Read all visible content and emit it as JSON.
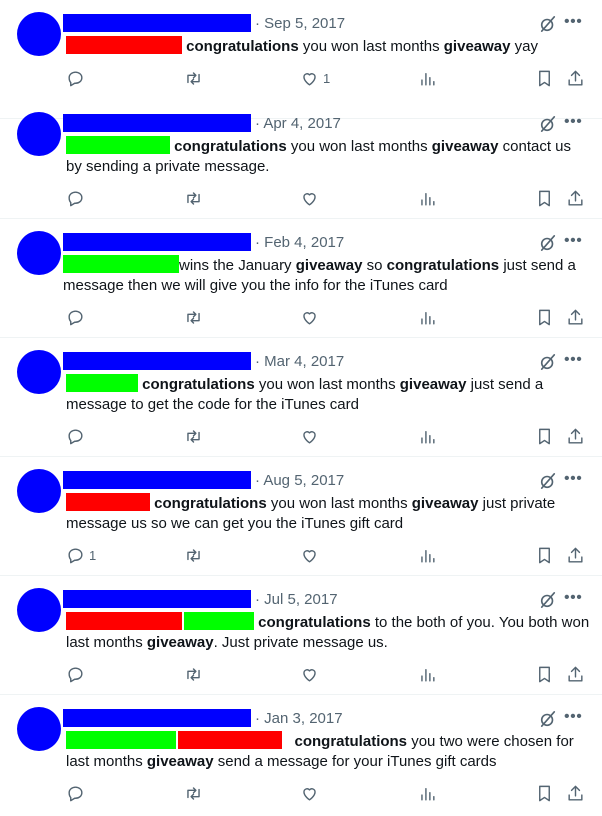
{
  "colors": {
    "avatar": "#0000ff",
    "name_redaction": "#0000ff",
    "red_redaction": "#ff0000",
    "green_redaction": "#00ff00",
    "muted": "#536471"
  },
  "icons": [
    "grok-icon",
    "more-icon",
    "reply-icon",
    "retweet-icon",
    "like-icon",
    "views-icon",
    "bookmark-icon",
    "share-icon"
  ],
  "tweets": [
    {
      "date": "· Sep 5, 2017",
      "segments": [
        [
          "congratulations",
          true
        ],
        [
          " you won last months ",
          false
        ],
        [
          "giveaway",
          true
        ],
        [
          " yay",
          false
        ]
      ],
      "reply_count": "",
      "like_count": "1"
    },
    {
      "date": "· Apr 4, 2017",
      "segments": [
        [
          "congratulations",
          true
        ],
        [
          " you won last months ",
          false
        ],
        [
          "giveaway",
          true
        ],
        [
          " contact us by sending a private message.",
          false
        ]
      ],
      "reply_count": "",
      "like_count": ""
    },
    {
      "date": "· Feb 4, 2017",
      "segments": [
        [
          "wins the January ",
          false
        ],
        [
          "giveaway",
          true
        ],
        [
          " so ",
          false
        ],
        [
          "congratulations",
          true
        ],
        [
          " just send a message then we will give you the info for the iTunes card",
          false
        ]
      ],
      "reply_count": "",
      "like_count": ""
    },
    {
      "date": "· Mar 4, 2017",
      "segments": [
        [
          "congratulations",
          true
        ],
        [
          " you won last months ",
          false
        ],
        [
          "giveaway",
          true
        ],
        [
          " just send a message to get the code for the iTunes card",
          false
        ]
      ],
      "reply_count": "",
      "like_count": ""
    },
    {
      "date": "· Aug 5, 2017",
      "segments": [
        [
          "congratulations",
          true
        ],
        [
          " you won last months ",
          false
        ],
        [
          "giveaway",
          true
        ],
        [
          " just private message us so we can get you the iTunes gift card",
          false
        ]
      ],
      "reply_count": "1",
      "like_count": ""
    },
    {
      "date": "· Jul 5, 2017",
      "segments": [
        [
          "congratulations",
          true
        ],
        [
          " to the both of you. You both won last months ",
          false
        ],
        [
          "giveaway",
          true
        ],
        [
          ". Just private message us.",
          false
        ]
      ],
      "reply_count": "",
      "like_count": ""
    },
    {
      "date": "· Jan 3, 2017",
      "segments": [
        [
          "congratulations",
          true
        ],
        [
          " you two were chosen for last months ",
          false
        ],
        [
          "giveaway",
          true
        ],
        [
          " send a message for your iTunes gift cards",
          false
        ]
      ],
      "reply_count": "",
      "like_count": ""
    }
  ]
}
